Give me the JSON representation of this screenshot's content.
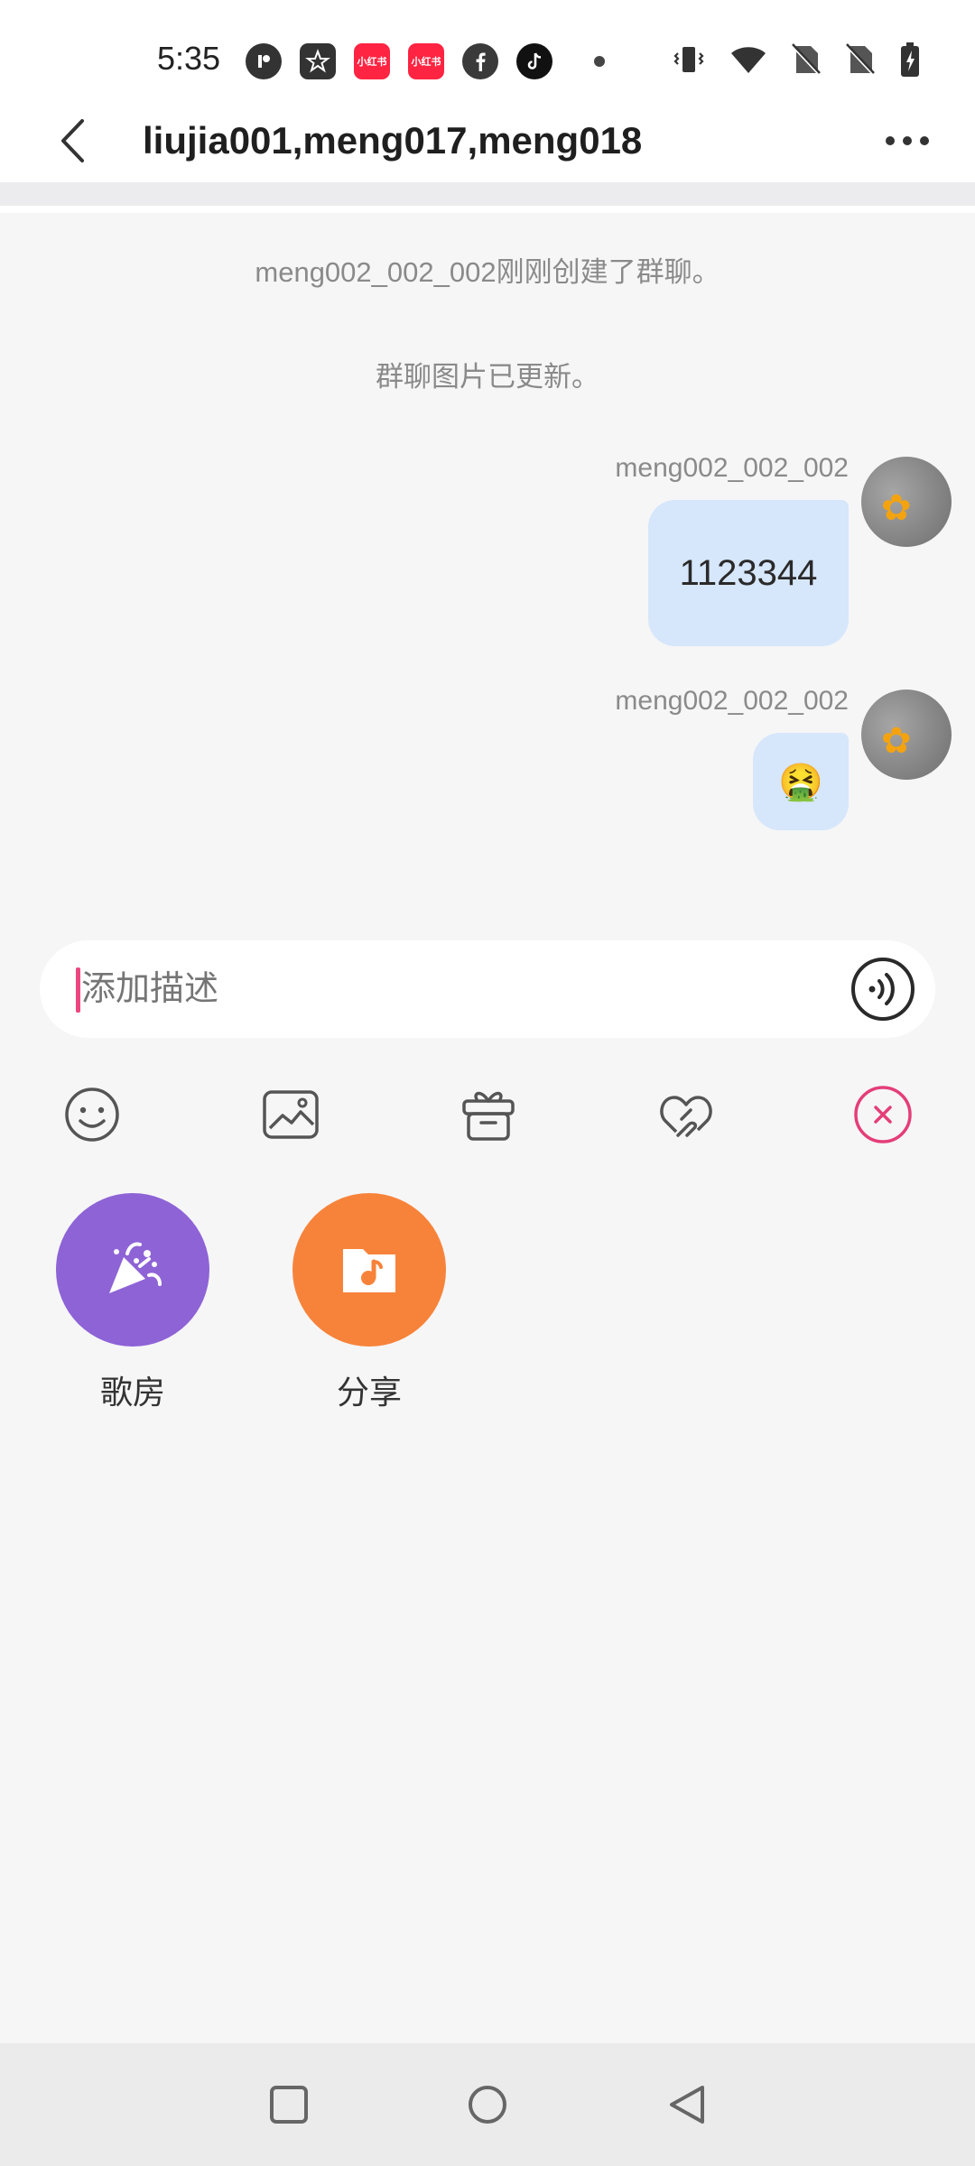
{
  "status_bar": {
    "time": "5:35",
    "notification_icons": [
      "app-icon",
      "star-icon",
      "xiaohongshu-icon",
      "xiaohongshu-icon",
      "facebook-icon",
      "tiktok-icon",
      "dot-icon"
    ],
    "xiaohongshu_text": "小红书",
    "system_icons": [
      "vibrate-icon",
      "wifi-icon",
      "no-sim-icon",
      "no-sim-icon",
      "battery-charging-icon"
    ]
  },
  "header": {
    "title": "liujia001,meng017,meng018"
  },
  "system_messages": [
    "meng002_002_002刚刚创建了群聊。",
    "群聊图片已更新。"
  ],
  "messages": [
    {
      "sender": "meng002_002_002",
      "text": "1123344"
    },
    {
      "sender": "meng002_002_002",
      "text": "🤮"
    }
  ],
  "input": {
    "placeholder": "添加描述",
    "value": ""
  },
  "toolbar": [
    "emoji-icon",
    "image-icon",
    "gift-icon",
    "match-icon",
    "close-icon"
  ],
  "apps": [
    {
      "label": "歌房",
      "color": "#8e63d6"
    },
    {
      "label": "分享",
      "color": "#f7833a"
    }
  ],
  "colors": {
    "accent": "#ec4680",
    "bubble": "#d6e6fb",
    "background": "#f6f6f7"
  }
}
